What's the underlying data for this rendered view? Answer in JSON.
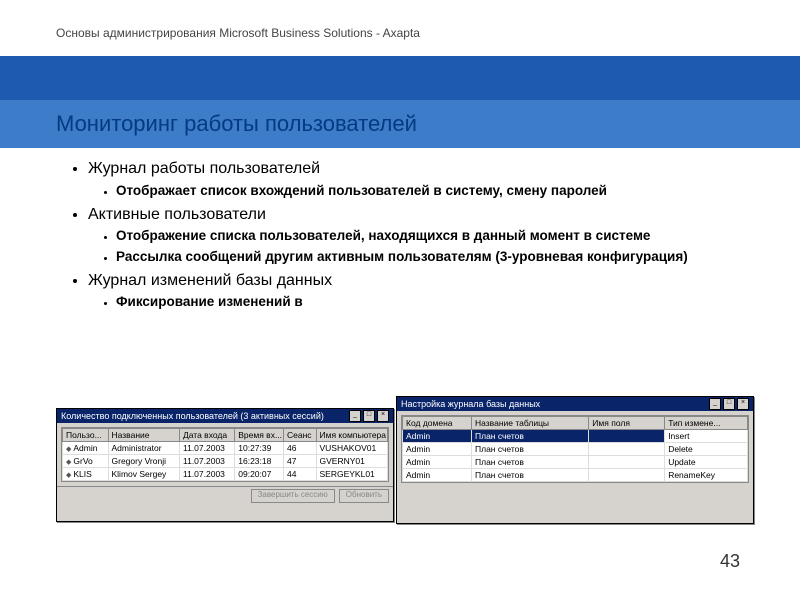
{
  "header": "Основы администрирования Microsoft Business Solutions - Axapta",
  "title": "Мониторинг работы пользователей",
  "bullets": {
    "b1": "Журнал работы пользователей",
    "b1a": "Отображает список вхождений пользователей в систему, смену паролей",
    "b2": "Активные пользователи",
    "b2a": "Отображение списка пользователей, находящихся в данный момент в системе",
    "b2b": "Рассылка сообщений другим активным пользователям (3-уровневая конфигурация)",
    "b3": "Журнал изменений базы данных",
    "b3a": "Фиксирование изменений в"
  },
  "win_left": {
    "title": "Количество подключенных пользователей (3 активных сессий)",
    "cols": {
      "c1": "Пользо...",
      "c2": "Название",
      "c3": "Дата входа",
      "c4": "Время вх...",
      "c5": "Сеанс",
      "c6": "Имя компьютера"
    },
    "rows": [
      {
        "user": "Admin",
        "name": "Administrator",
        "date": "11.07.2003",
        "time": "10:27:39",
        "sess": "46",
        "host": "VUSHAKOV01"
      },
      {
        "user": "GrVo",
        "name": "Gregory Vronji",
        "date": "11.07.2003",
        "time": "16:23:18",
        "sess": "47",
        "host": "GVERNY01"
      },
      {
        "user": "KLIS",
        "name": "Klimov Sergey",
        "date": "11.07.2003",
        "time": "09:20:07",
        "sess": "44",
        "host": "SERGEYKL01"
      }
    ],
    "btn1": "Завершить сессию",
    "btn2": "Обновить"
  },
  "win_right": {
    "title": "Настройка журнала базы данных",
    "cols": {
      "c1": "Код домена",
      "c2": "Название таблицы",
      "c3": "Имя поля",
      "c4": "Тип измене..."
    },
    "rows": [
      {
        "domain": "Admin",
        "table": "План счетов",
        "field": "",
        "type": "Insert"
      },
      {
        "domain": "Admin",
        "table": "План счетов",
        "field": "",
        "type": "Delete"
      },
      {
        "domain": "Admin",
        "table": "План счетов",
        "field": "",
        "type": "Update"
      },
      {
        "domain": "Admin",
        "table": "План счетов",
        "field": "",
        "type": "RenameKey"
      }
    ]
  },
  "page_number": "43",
  "window_controls": {
    "min": "_",
    "max": "□",
    "close": "×"
  }
}
